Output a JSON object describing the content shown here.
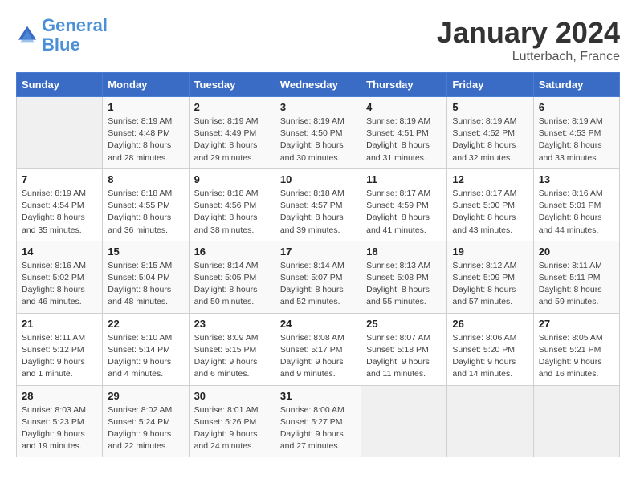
{
  "header": {
    "logo_line1": "General",
    "logo_line2": "Blue",
    "month": "January 2024",
    "location": "Lutterbach, France"
  },
  "weekdays": [
    "Sunday",
    "Monday",
    "Tuesday",
    "Wednesday",
    "Thursday",
    "Friday",
    "Saturday"
  ],
  "weeks": [
    [
      {
        "day": "",
        "sunrise": "",
        "sunset": "",
        "daylight": ""
      },
      {
        "day": "1",
        "sunrise": "Sunrise: 8:19 AM",
        "sunset": "Sunset: 4:48 PM",
        "daylight": "Daylight: 8 hours and 28 minutes."
      },
      {
        "day": "2",
        "sunrise": "Sunrise: 8:19 AM",
        "sunset": "Sunset: 4:49 PM",
        "daylight": "Daylight: 8 hours and 29 minutes."
      },
      {
        "day": "3",
        "sunrise": "Sunrise: 8:19 AM",
        "sunset": "Sunset: 4:50 PM",
        "daylight": "Daylight: 8 hours and 30 minutes."
      },
      {
        "day": "4",
        "sunrise": "Sunrise: 8:19 AM",
        "sunset": "Sunset: 4:51 PM",
        "daylight": "Daylight: 8 hours and 31 minutes."
      },
      {
        "day": "5",
        "sunrise": "Sunrise: 8:19 AM",
        "sunset": "Sunset: 4:52 PM",
        "daylight": "Daylight: 8 hours and 32 minutes."
      },
      {
        "day": "6",
        "sunrise": "Sunrise: 8:19 AM",
        "sunset": "Sunset: 4:53 PM",
        "daylight": "Daylight: 8 hours and 33 minutes."
      }
    ],
    [
      {
        "day": "7",
        "sunrise": "Sunrise: 8:19 AM",
        "sunset": "Sunset: 4:54 PM",
        "daylight": "Daylight: 8 hours and 35 minutes."
      },
      {
        "day": "8",
        "sunrise": "Sunrise: 8:18 AM",
        "sunset": "Sunset: 4:55 PM",
        "daylight": "Daylight: 8 hours and 36 minutes."
      },
      {
        "day": "9",
        "sunrise": "Sunrise: 8:18 AM",
        "sunset": "Sunset: 4:56 PM",
        "daylight": "Daylight: 8 hours and 38 minutes."
      },
      {
        "day": "10",
        "sunrise": "Sunrise: 8:18 AM",
        "sunset": "Sunset: 4:57 PM",
        "daylight": "Daylight: 8 hours and 39 minutes."
      },
      {
        "day": "11",
        "sunrise": "Sunrise: 8:17 AM",
        "sunset": "Sunset: 4:59 PM",
        "daylight": "Daylight: 8 hours and 41 minutes."
      },
      {
        "day": "12",
        "sunrise": "Sunrise: 8:17 AM",
        "sunset": "Sunset: 5:00 PM",
        "daylight": "Daylight: 8 hours and 43 minutes."
      },
      {
        "day": "13",
        "sunrise": "Sunrise: 8:16 AM",
        "sunset": "Sunset: 5:01 PM",
        "daylight": "Daylight: 8 hours and 44 minutes."
      }
    ],
    [
      {
        "day": "14",
        "sunrise": "Sunrise: 8:16 AM",
        "sunset": "Sunset: 5:02 PM",
        "daylight": "Daylight: 8 hours and 46 minutes."
      },
      {
        "day": "15",
        "sunrise": "Sunrise: 8:15 AM",
        "sunset": "Sunset: 5:04 PM",
        "daylight": "Daylight: 8 hours and 48 minutes."
      },
      {
        "day": "16",
        "sunrise": "Sunrise: 8:14 AM",
        "sunset": "Sunset: 5:05 PM",
        "daylight": "Daylight: 8 hours and 50 minutes."
      },
      {
        "day": "17",
        "sunrise": "Sunrise: 8:14 AM",
        "sunset": "Sunset: 5:07 PM",
        "daylight": "Daylight: 8 hours and 52 minutes."
      },
      {
        "day": "18",
        "sunrise": "Sunrise: 8:13 AM",
        "sunset": "Sunset: 5:08 PM",
        "daylight": "Daylight: 8 hours and 55 minutes."
      },
      {
        "day": "19",
        "sunrise": "Sunrise: 8:12 AM",
        "sunset": "Sunset: 5:09 PM",
        "daylight": "Daylight: 8 hours and 57 minutes."
      },
      {
        "day": "20",
        "sunrise": "Sunrise: 8:11 AM",
        "sunset": "Sunset: 5:11 PM",
        "daylight": "Daylight: 8 hours and 59 minutes."
      }
    ],
    [
      {
        "day": "21",
        "sunrise": "Sunrise: 8:11 AM",
        "sunset": "Sunset: 5:12 PM",
        "daylight": "Daylight: 9 hours and 1 minute."
      },
      {
        "day": "22",
        "sunrise": "Sunrise: 8:10 AM",
        "sunset": "Sunset: 5:14 PM",
        "daylight": "Daylight: 9 hours and 4 minutes."
      },
      {
        "day": "23",
        "sunrise": "Sunrise: 8:09 AM",
        "sunset": "Sunset: 5:15 PM",
        "daylight": "Daylight: 9 hours and 6 minutes."
      },
      {
        "day": "24",
        "sunrise": "Sunrise: 8:08 AM",
        "sunset": "Sunset: 5:17 PM",
        "daylight": "Daylight: 9 hours and 9 minutes."
      },
      {
        "day": "25",
        "sunrise": "Sunrise: 8:07 AM",
        "sunset": "Sunset: 5:18 PM",
        "daylight": "Daylight: 9 hours and 11 minutes."
      },
      {
        "day": "26",
        "sunrise": "Sunrise: 8:06 AM",
        "sunset": "Sunset: 5:20 PM",
        "daylight": "Daylight: 9 hours and 14 minutes."
      },
      {
        "day": "27",
        "sunrise": "Sunrise: 8:05 AM",
        "sunset": "Sunset: 5:21 PM",
        "daylight": "Daylight: 9 hours and 16 minutes."
      }
    ],
    [
      {
        "day": "28",
        "sunrise": "Sunrise: 8:03 AM",
        "sunset": "Sunset: 5:23 PM",
        "daylight": "Daylight: 9 hours and 19 minutes."
      },
      {
        "day": "29",
        "sunrise": "Sunrise: 8:02 AM",
        "sunset": "Sunset: 5:24 PM",
        "daylight": "Daylight: 9 hours and 22 minutes."
      },
      {
        "day": "30",
        "sunrise": "Sunrise: 8:01 AM",
        "sunset": "Sunset: 5:26 PM",
        "daylight": "Daylight: 9 hours and 24 minutes."
      },
      {
        "day": "31",
        "sunrise": "Sunrise: 8:00 AM",
        "sunset": "Sunset: 5:27 PM",
        "daylight": "Daylight: 9 hours and 27 minutes."
      },
      {
        "day": "",
        "sunrise": "",
        "sunset": "",
        "daylight": ""
      },
      {
        "day": "",
        "sunrise": "",
        "sunset": "",
        "daylight": ""
      },
      {
        "day": "",
        "sunrise": "",
        "sunset": "",
        "daylight": ""
      }
    ]
  ]
}
